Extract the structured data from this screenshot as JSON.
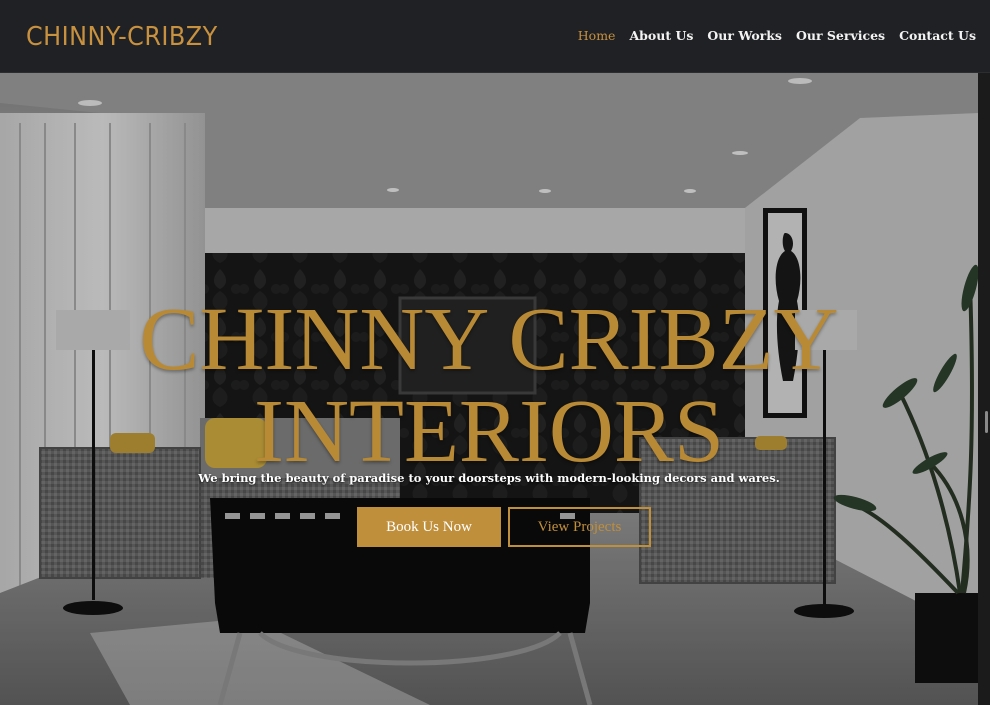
{
  "brand": {
    "logo_text": "CHINNY-CRIBZY",
    "accent": "#c08f3b"
  },
  "nav": {
    "items": [
      {
        "label": "Home",
        "active": true
      },
      {
        "label": "About Us",
        "active": false
      },
      {
        "label": "Our Works",
        "active": false
      },
      {
        "label": "Our Services",
        "active": false
      },
      {
        "label": "Contact Us",
        "active": false
      }
    ]
  },
  "hero": {
    "title_line1": "CHINNY CRIBZY",
    "title_line2": "INTERIORS",
    "tagline": "We bring the beauty of paradise to your doorsteps with modern-looking decors and wares.",
    "primary_button": "Book Us Now",
    "secondary_button": "View Projects",
    "background_image": "grayscale modern living room with sofas, floor lamps, TV wall, plant"
  }
}
